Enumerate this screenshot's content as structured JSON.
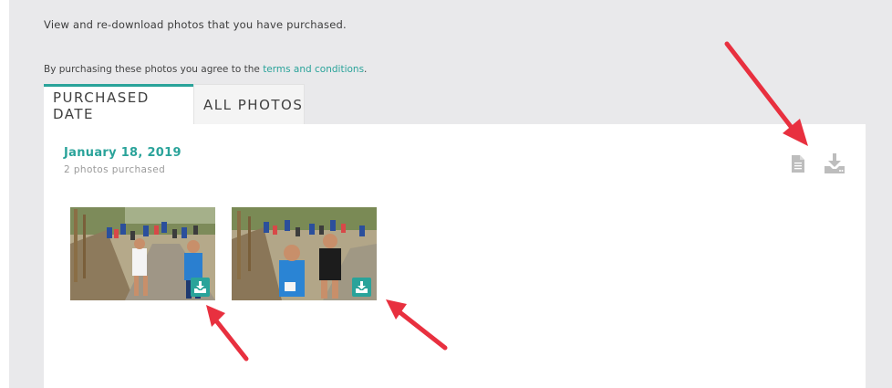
{
  "intro": {
    "text": "View and re-download photos that you have purchased."
  },
  "terms": {
    "prefix": "By purchasing these photos you agree to the ",
    "link": "terms and conditions",
    "suffix": "."
  },
  "tabs": [
    {
      "label": "PURCHASED DATE",
      "active": true
    },
    {
      "label": "ALL PHOTOS",
      "active": false
    }
  ],
  "group": {
    "date": "January 18, 2019",
    "count": "2 photos purchased",
    "actions": [
      {
        "icon": "document-icon"
      },
      {
        "icon": "download-icon"
      }
    ]
  },
  "photos": [
    {
      "subject": "marathon runners on dirt path",
      "action_icon": "download-icon"
    },
    {
      "subject": "marathon runners on dirt path",
      "action_icon": "download-icon"
    }
  ],
  "colors": {
    "accent": "#2aa39a",
    "background": "#e9e9eb",
    "panel": "#ffffff",
    "annotation": "#e8303f"
  }
}
